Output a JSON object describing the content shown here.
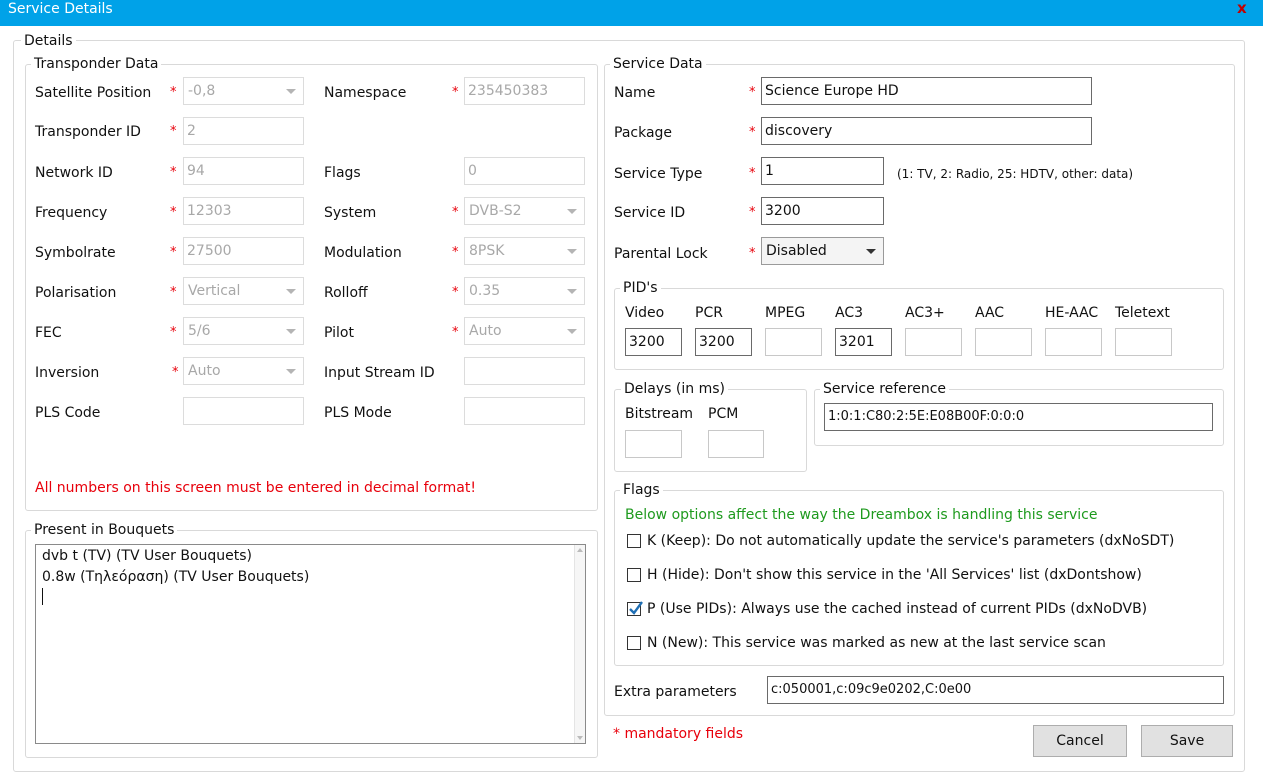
{
  "window": {
    "title": "Service Details",
    "close_glyph": "x"
  },
  "details_legend": "Details",
  "transponder": {
    "legend": "Transponder Data",
    "satellite_position": {
      "label": "Satellite Position",
      "value": "-0,8"
    },
    "namespace": {
      "label": "Namespace",
      "value": "235450383"
    },
    "transponder_id": {
      "label": "Transponder ID",
      "value": "2"
    },
    "network_id": {
      "label": "Network ID",
      "value": "94"
    },
    "flags": {
      "label": "Flags",
      "value": "0"
    },
    "frequency": {
      "label": "Frequency",
      "value": "12303"
    },
    "system": {
      "label": "System",
      "value": "DVB-S2"
    },
    "symbolrate": {
      "label": "Symbolrate",
      "value": "27500"
    },
    "modulation": {
      "label": "Modulation",
      "value": "8PSK"
    },
    "polarisation": {
      "label": "Polarisation",
      "value": "Vertical"
    },
    "rolloff": {
      "label": "Rolloff",
      "value": "0.35"
    },
    "fec": {
      "label": "FEC",
      "value": "5/6"
    },
    "pilot": {
      "label": "Pilot",
      "value": "Auto"
    },
    "inversion": {
      "label": "Inversion",
      "value": "Auto"
    },
    "input_stream_id": {
      "label": "Input Stream ID",
      "value": ""
    },
    "pls_code": {
      "label": "PLS Code",
      "value": ""
    },
    "pls_mode": {
      "label": "PLS Mode",
      "value": ""
    },
    "decimal_note": "All numbers on this screen must be entered in decimal format!",
    "required_mark": "*"
  },
  "bouquets": {
    "legend": "Present in Bouquets",
    "items": [
      "dvb t (TV) (TV User Bouquets)",
      "0.8w (Τηλεόραση) (TV User Bouquets)"
    ]
  },
  "service": {
    "legend": "Service Data",
    "name": {
      "label": "Name",
      "value": "Science Europe HD"
    },
    "package": {
      "label": "Package",
      "value": "discovery"
    },
    "service_type": {
      "label": "Service Type",
      "value": "1",
      "hint": "(1: TV, 2: Radio, 25: HDTV, other: data)"
    },
    "service_id": {
      "label": "Service ID",
      "value": "3200"
    },
    "parental_lock": {
      "label": "Parental Lock",
      "value": "Disabled"
    }
  },
  "pids": {
    "legend": "PID's",
    "columns": [
      {
        "label": "Video",
        "value": "3200"
      },
      {
        "label": "PCR",
        "value": "3200"
      },
      {
        "label": "MPEG",
        "value": ""
      },
      {
        "label": "AC3",
        "value": "3201"
      },
      {
        "label": "AC3+",
        "value": ""
      },
      {
        "label": "AAC",
        "value": ""
      },
      {
        "label": "HE-AAC",
        "value": ""
      },
      {
        "label": "Teletext",
        "value": ""
      }
    ]
  },
  "delays": {
    "legend": "Delays (in ms)",
    "bitstream": {
      "label": "Bitstream",
      "value": ""
    },
    "pcm": {
      "label": "PCM",
      "value": ""
    }
  },
  "service_reference": {
    "legend": "Service reference",
    "value": "1:0:1:C80:2:5E:E08B00F:0:0:0"
  },
  "flags_group": {
    "legend": "Flags",
    "note": "Below options affect the way the Dreambox is handling this service",
    "items": [
      {
        "label": "K (Keep): Do not automatically update the service's parameters (dxNoSDT)",
        "checked": false
      },
      {
        "label": "H (Hide): Don't show this service in the 'All Services' list (dxDontshow)",
        "checked": false
      },
      {
        "label": "P (Use PIDs): Always use the cached instead of current PIDs (dxNoDVB)",
        "checked": true
      },
      {
        "label": "N (New): This service was marked as new at the last service scan",
        "checked": false
      }
    ]
  },
  "extra_parameters": {
    "label": "Extra parameters",
    "value": "c:050001,c:09c9e0202,C:0e00"
  },
  "mandatory_note": "* mandatory fields",
  "buttons": {
    "cancel": "Cancel",
    "save": "Save"
  },
  "colors": {
    "titlebar": "#00a2e8",
    "required": "#e8000b",
    "note_green": "#1e9a1e",
    "checkmark": "#1f6fb5"
  }
}
